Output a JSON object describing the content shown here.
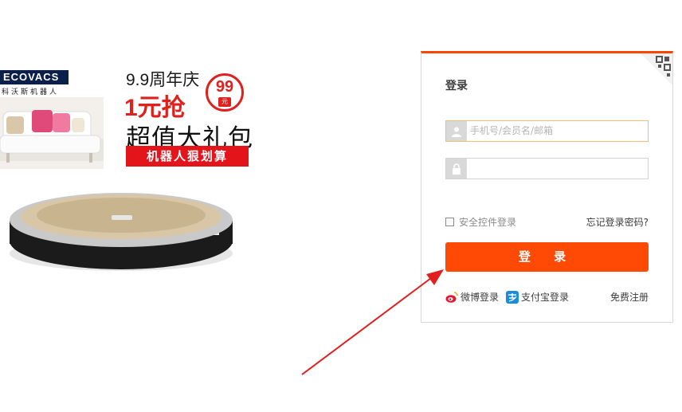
{
  "banner": {
    "brand": "ECOVACS",
    "brand_sub": "科沃斯机器人",
    "anniversary": "9.9周年庆",
    "promo_price": "1元抢",
    "badge_number": "99",
    "badge_unit": "元",
    "headline": "超值大礼包",
    "subline": "机器人狠划算"
  },
  "login": {
    "title": "登录",
    "username_placeholder": "手机号/会员名/邮箱",
    "password_value": "",
    "safe_control_label": "安全控件登录",
    "safe_control_checked": false,
    "forgot_password": "忘记登录密码?",
    "submit_label": "登 录",
    "weibo_login": "微博登录",
    "alipay_login": "支付宝登录",
    "register": "免费注册"
  },
  "colors": {
    "accent": "#ff4a05",
    "panel_top_border": "#ff4400",
    "promo_red": "#e4141b",
    "arrow": "#e21f1f"
  },
  "icons": {
    "qr": "qr-code-icon",
    "user": "user-icon",
    "lock": "lock-icon",
    "weibo": "weibo-icon",
    "alipay": "alipay-icon"
  }
}
